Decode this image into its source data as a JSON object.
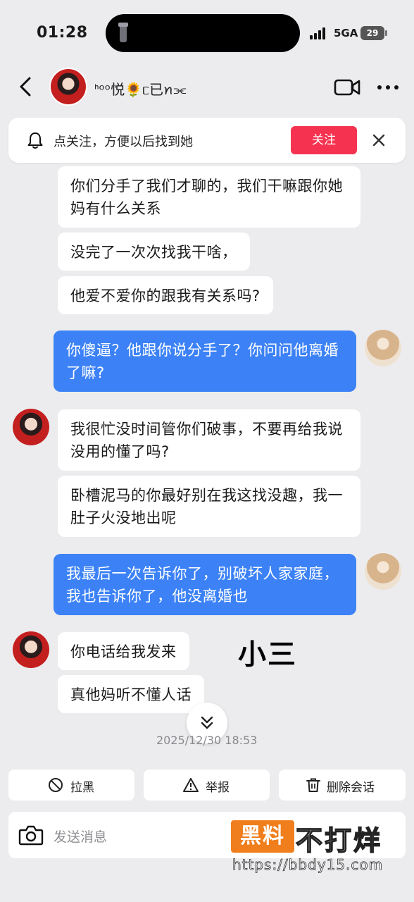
{
  "status_bar": {
    "time": "01:28",
    "network": "5GA",
    "battery": "29"
  },
  "header": {
    "contact_name": "ᑋᵒᵒ悦🌻ᥴ已ꪀ⫘"
  },
  "follow_banner": {
    "text": "点关注，方便以后找到她",
    "button": "关注"
  },
  "messages": [
    {
      "side": "left",
      "text": "你们分手了我们才聊的，我们干嘛跟你她妈有什么关系"
    },
    {
      "side": "left",
      "text": "没完了一次次找我干啥，"
    },
    {
      "side": "left",
      "text": "他爱不爱你的跟我有关系吗?"
    },
    {
      "side": "right",
      "text": "你傻逼？他跟你说分手了？你问问他离婚了嘛?"
    },
    {
      "side": "left",
      "text": "我很忙没时间管你们破事，不要再给我说没用的懂了吗?"
    },
    {
      "side": "left",
      "text": "卧槽泥马的你最好别在我这找没趣，我一肚子火没地出呢"
    },
    {
      "side": "right",
      "text": "我最后一次告诉你了，别破坏人家家庭，我也告诉你了，他没离婚也"
    },
    {
      "side": "left",
      "text": "你电话给我发来"
    },
    {
      "side": "left",
      "text": "真他妈听不懂人话"
    }
  ],
  "annotation": "小三",
  "timestamp": "2025/12/30 18:53",
  "actions": {
    "block": "拉黑",
    "report": "举报",
    "delete": "删除会话"
  },
  "input": {
    "placeholder": "发送消息"
  },
  "watermark": {
    "badge": "黑料",
    "text": "不打烊",
    "url": "https://bbdy15.com"
  }
}
